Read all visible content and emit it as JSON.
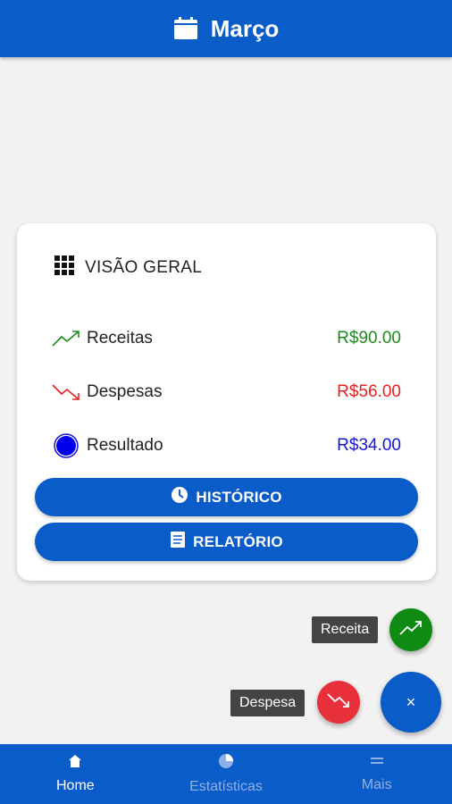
{
  "header": {
    "title": "Março",
    "icon": "calendar-icon"
  },
  "overview": {
    "title": "VISÃO GERAL",
    "rows": [
      {
        "label": "Receitas",
        "value": "R$90.00",
        "color": "#1e8a1e",
        "icon": "trending-up-icon"
      },
      {
        "label": "Despesas",
        "value": "R$56.00",
        "color": "#e82020",
        "icon": "trending-down-icon"
      },
      {
        "label": "Resultado",
        "value": "R$34.00",
        "color": "#1414d8",
        "icon": "circle-icon"
      }
    ],
    "buttons": {
      "history": "HISTÓRICO",
      "report": "RELATÓRIO"
    }
  },
  "fab": {
    "income_label": "Receita",
    "expense_label": "Despesa",
    "close_symbol": "×"
  },
  "nav": [
    {
      "label": "Home",
      "icon": "home-icon",
      "active": true
    },
    {
      "label": "Estatísticas",
      "icon": "pie-chart-icon",
      "active": false
    },
    {
      "label": "Mais",
      "icon": "menu-icon",
      "active": false
    }
  ],
  "colors": {
    "primary": "#0a5cc8",
    "income": "#0f8a12",
    "expense": "#e8303a"
  }
}
